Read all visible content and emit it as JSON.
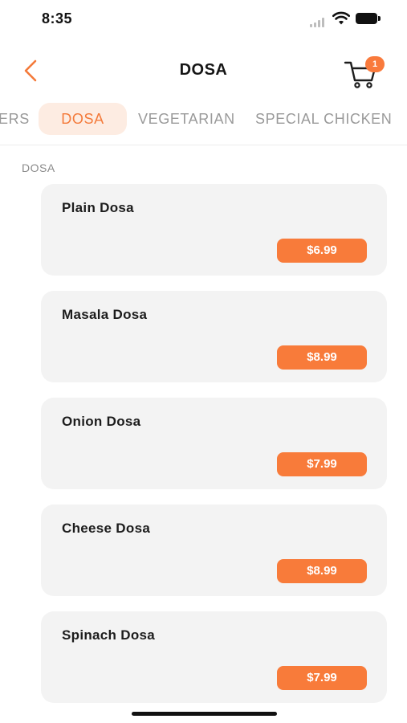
{
  "status_bar": {
    "time": "8:35"
  },
  "header": {
    "title": "DOSA",
    "cart_count": "1"
  },
  "tabs": [
    {
      "label": "ERS",
      "active": false
    },
    {
      "label": "DOSA",
      "active": true
    },
    {
      "label": "VEGETARIAN",
      "active": false
    },
    {
      "label": "SPECIAL CHICKEN",
      "active": false
    }
  ],
  "section": {
    "label": "DOSA"
  },
  "items": [
    {
      "name": "Plain Dosa",
      "price": "$6.99"
    },
    {
      "name": "Masala Dosa",
      "price": "$8.99"
    },
    {
      "name": "Onion Dosa",
      "price": "$7.99"
    },
    {
      "name": "Cheese Dosa",
      "price": "$8.99"
    },
    {
      "name": "Spinach Dosa",
      "price": "$7.99"
    }
  ],
  "colors": {
    "accent": "#f87b3a",
    "active_tab_bg": "#fdece2",
    "card_bg": "#f3f3f3"
  },
  "icons": {
    "back": "chevron-left-icon",
    "cart": "cart-icon",
    "signal": "signal-icon",
    "wifi": "wifi-icon",
    "battery": "battery-icon"
  }
}
